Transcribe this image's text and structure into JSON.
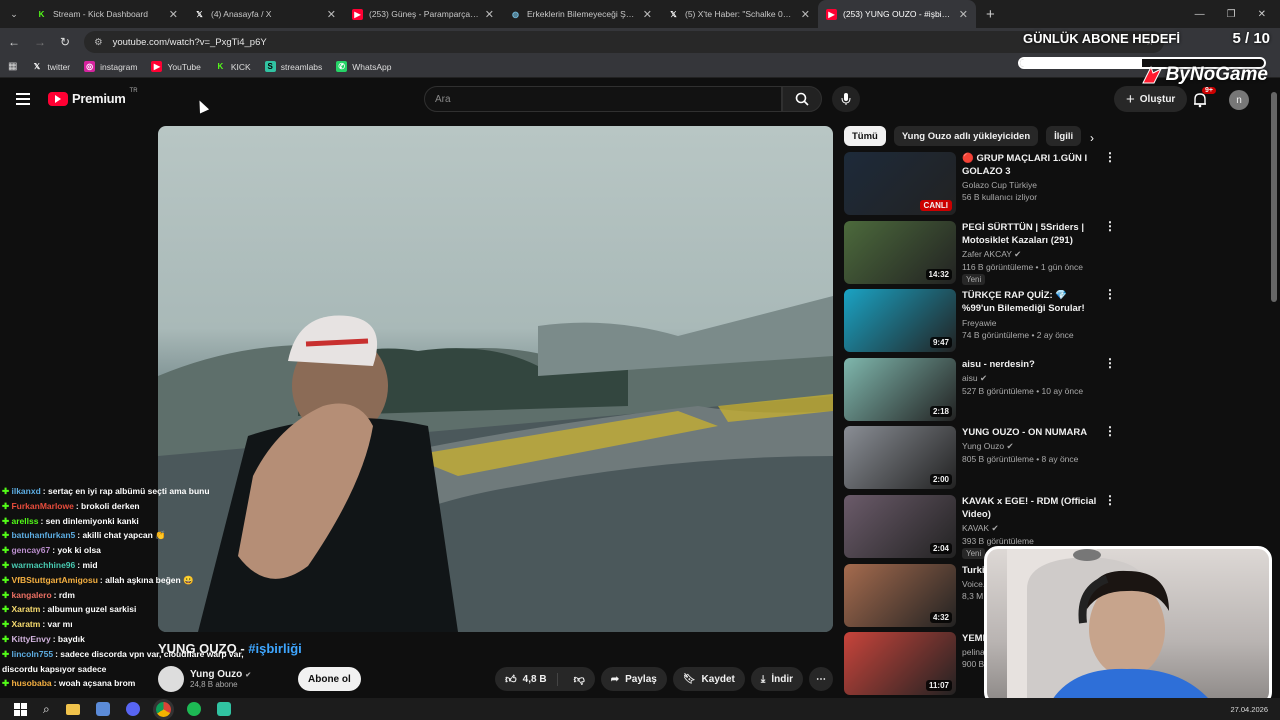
{
  "browser": {
    "tabs": [
      {
        "title": "Stream - Kick Dashboard",
        "icon": "kick-icon",
        "color": "#53fc18",
        "active": false
      },
      {
        "title": "(4) Anasayfa / X",
        "icon": "x-icon",
        "color": "#ffffff",
        "active": false
      },
      {
        "title": "(253) Güneş - Paramparça (Offi",
        "icon": "youtube-icon",
        "color": "#ff0033",
        "active": false
      },
      {
        "title": "Erkeklerin Bilemeyeceği Şeyler",
        "icon": "globe-icon",
        "color": "#6fb3d2",
        "active": false
      },
      {
        "title": "(5) X'te Haber: \"Schalke 04'ün",
        "icon": "x-icon",
        "color": "#ffffff",
        "active": false
      },
      {
        "title": "(253) YUNG OUZO - #işbirliği",
        "icon": "youtube-icon",
        "color": "#ff0033",
        "active": true
      }
    ],
    "url": "youtube.com/watch?v=_PxgTi4_p6Y",
    "bookmarks": [
      {
        "label": "twitter",
        "icon": "x-icon"
      },
      {
        "label": "instagram",
        "icon": "instagram-icon"
      },
      {
        "label": "YouTube",
        "icon": "youtube-icon"
      },
      {
        "label": "KICK",
        "icon": "kick-icon"
      },
      {
        "label": "streamlabs",
        "icon": "streamlabs-icon"
      },
      {
        "label": "WhatsApp",
        "icon": "whatsapp-icon"
      }
    ]
  },
  "overlay": {
    "goal_title": "GÜNLÜK ABONE HEDEFİ",
    "goal_count": "5 / 10",
    "goal_progress": 0.5,
    "brand": "ByNoGame"
  },
  "youtube": {
    "logo_text": "Premium",
    "logo_badge": "TR",
    "search_placeholder": "Ara",
    "create_label": "Oluştur",
    "notif_count": "9+",
    "avatar_letter": "n",
    "video": {
      "title_main": "YUNG OUZO - ",
      "title_tag": "#işbirliği",
      "channel": "Yung Ouzo",
      "subs": "24,8 B abone",
      "subscribe": "Abone ol",
      "likes": "4,8 B",
      "share": "Paylaş",
      "save": "Kaydet",
      "download": "İndir"
    },
    "chips": [
      "Tümü",
      "Yung Ouzo adlı yükleyiciden",
      "İlgili"
    ],
    "recommendations": [
      {
        "title": "🔴 GRUP MAÇLARI 1.GÜN I GOLAZO 3",
        "channel": "Golazo Cup Türkiye",
        "meta": "56 B kullanıcı izliyor",
        "badge": "CANLI",
        "live": true,
        "verified": false,
        "new": "",
        "thumb": "#1d2a3a"
      },
      {
        "title": "PEGİ SÜRTTÜN | 5Sriders | Motosiklet Kazaları (291)",
        "channel": "Zafer AKCAY",
        "meta": "116 B görüntüleme • 1 gün önce",
        "badge": "14:32",
        "live": false,
        "verified": true,
        "new": "Yeni",
        "thumb": "#4c6a3c"
      },
      {
        "title": "TÜRKÇE RAP QUİZ: 💎 %99'un Bilemediği Sorular! 👑",
        "channel": "Freyawie",
        "meta": "74 B görüntüleme • 2 ay önce",
        "badge": "9:47",
        "live": false,
        "verified": false,
        "new": "",
        "thumb": "#1aa3c4"
      },
      {
        "title": "aisu - nerdesin?",
        "channel": "aisu",
        "meta": "527 B görüntüleme • 10 ay önce",
        "badge": "2:18",
        "live": false,
        "verified": true,
        "new": "",
        "thumb": "#7fb7ad"
      },
      {
        "title": "YUNG OUZO - ON NUMARA",
        "channel": "Yung Ouzo",
        "meta": "805 B görüntüleme • 8 ay önce",
        "badge": "2:00",
        "live": false,
        "verified": true,
        "new": "",
        "thumb": "#8a8e95"
      },
      {
        "title": "KAVAK x EGE! - RDM (Official Video)",
        "channel": "KAVAK",
        "meta": "393 B görüntüleme",
        "badge": "2:04",
        "live": false,
        "verified": true,
        "new": "Yeni",
        "thumb": "#6b5b6a"
      },
      {
        "title": "Turki... Prote...",
        "channel": "Voice...",
        "meta": "8,3 M...",
        "badge": "4:32",
        "live": false,
        "verified": false,
        "new": "",
        "thumb": "#a56b4e"
      },
      {
        "title": "YEMI...",
        "channel": "pelina...",
        "meta": "900 B...",
        "badge": "11:07",
        "live": false,
        "verified": false,
        "new": "",
        "thumb": "#c8443b"
      }
    ]
  },
  "chat": [
    {
      "user": "ilkanxd",
      "color": "#5dade2",
      "msg": "sertaç en iyi rap albümü seçti ama bunu"
    },
    {
      "user": "FurkanMarlowe",
      "color": "#e74c3c",
      "msg": "brokoli derken"
    },
    {
      "user": "arellss",
      "color": "#53fc18",
      "msg": "sen dinlemiyonki kanki"
    },
    {
      "user": "batuhanfurkan5",
      "color": "#5dade2",
      "msg": "akilli chat yapcan 👏"
    },
    {
      "user": "gencay67",
      "color": "#bb8fce",
      "msg": "yok ki olsa"
    },
    {
      "user": "warmachhine96",
      "color": "#48c9b0",
      "msg": "mid"
    },
    {
      "user": "VfBStuttgartAmigosu",
      "color": "#f5b041",
      "msg": "allah aşkına beğen 😀"
    },
    {
      "user": "kangalero",
      "color": "#ec7063",
      "msg": "rdm"
    },
    {
      "user": "Xaratm",
      "color": "#f7dc6f",
      "msg": "albumun guzel sarkisi"
    },
    {
      "user": "Xaratm",
      "color": "#f7dc6f",
      "msg": "var mı"
    },
    {
      "user": "KittyEnvy",
      "color": "#d2b4de",
      "msg": "baydık"
    },
    {
      "user": "lincoln755",
      "color": "#5dade2",
      "msg": "sadece discorda vpn var, cloudflare warp var, discordu kapsıyor sadece"
    },
    {
      "user": "husobaba",
      "color": "#f5b041",
      "msg": "woah açsana brom"
    }
  ],
  "taskbar": {
    "date": "27.04.2026"
  }
}
